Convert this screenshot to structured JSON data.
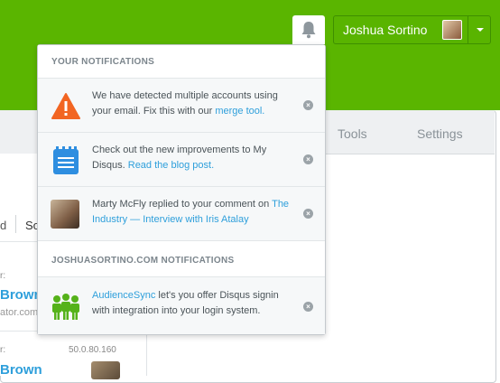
{
  "header": {
    "user_name": "Joshua Sortino"
  },
  "tabs": [
    "Tools",
    "Settings"
  ],
  "background": {
    "filter_d": "d",
    "filter_so": "So",
    "colon1": "r:",
    "name1": "Brown",
    "site1": "ator.com",
    "colon2": "r:",
    "ip": "50.0.80.160",
    "name2": "Brown"
  },
  "dropdown": {
    "section1_title": "YOUR NOTIFICATIONS",
    "section2_title": "JOSHUASORTINO.COM NOTIFICATIONS",
    "notifications": [
      {
        "icon": "warning-icon",
        "text": "We have detected multiple accounts using your email. Fix this with our ",
        "link": "merge tool."
      },
      {
        "icon": "notepad-icon",
        "text": "Check out the new improvements to My Disqus. ",
        "link": "Read the blog post."
      },
      {
        "icon": "avatar",
        "text": "Marty McFly replied to your comment on ",
        "link": "The Industry — Interview with Iris Atalay"
      },
      {
        "icon": "people-icon",
        "link": "AudienceSync",
        "text": " let's you offer Disqus signin with integration into your login system."
      }
    ]
  },
  "colors": {
    "brand_green": "#5ab500",
    "link_blue": "#2e9fdb",
    "warning_orange": "#f26522",
    "notepad_blue": "#2e8ee0",
    "people_green": "#55b21a"
  }
}
